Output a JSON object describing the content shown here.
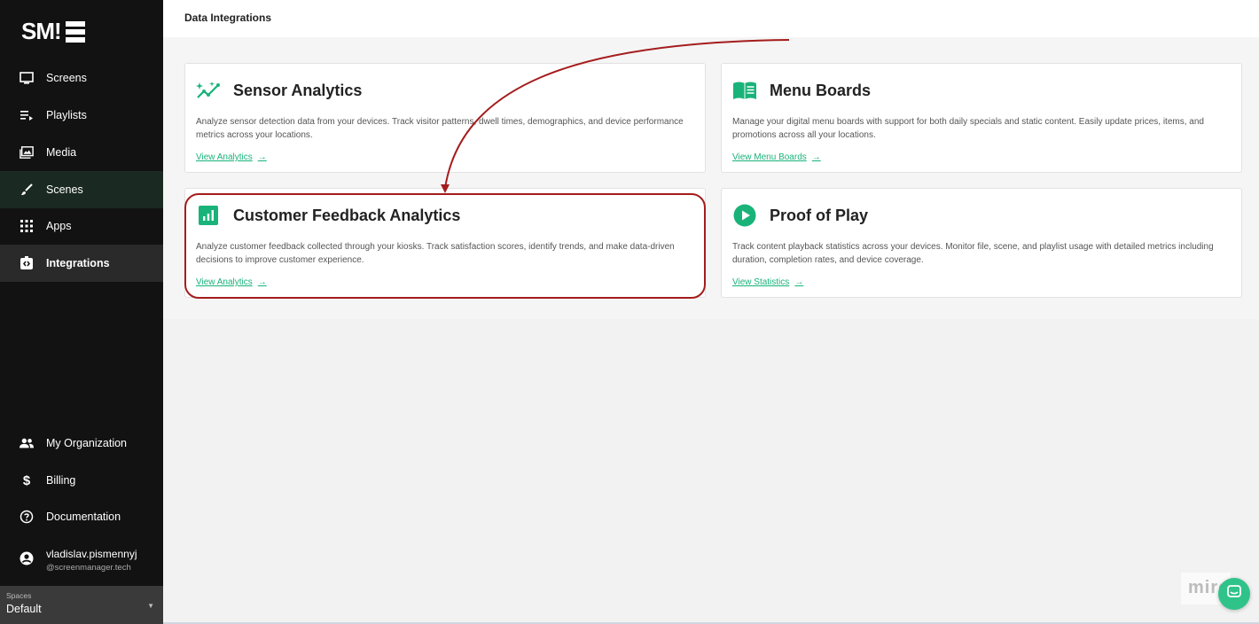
{
  "app": {
    "logo_text": "SM!",
    "logo_alt": "SM logo"
  },
  "sidebar": {
    "items": [
      {
        "label": "Screens",
        "icon": "monitor-icon"
      },
      {
        "label": "Playlists",
        "icon": "playlist-icon"
      },
      {
        "label": "Media",
        "icon": "media-icon"
      },
      {
        "label": "Scenes",
        "icon": "brush-icon"
      },
      {
        "label": "Apps",
        "icon": "apps-grid-icon"
      },
      {
        "label": "Integrations",
        "icon": "integrations-icon",
        "active": true
      }
    ],
    "bottom_items": [
      {
        "label": "My Organization",
        "icon": "people-icon"
      },
      {
        "label": "Billing",
        "icon": "dollar-icon"
      },
      {
        "label": "Documentation",
        "icon": "help-circle-icon"
      }
    ],
    "user": {
      "name": "vladislav.pismennyj",
      "email": "@screenmanager.tech"
    },
    "spaces": {
      "label": "Spaces",
      "value": "Default"
    }
  },
  "header": {
    "title": "Data Integrations"
  },
  "cards": [
    {
      "title": "Sensor Analytics",
      "icon": "sparkle-chart-icon",
      "description": "Analyze sensor detection data from your devices. Track visitor patterns, dwell times, demographics, and device performance metrics across your locations.",
      "link": "View Analytics",
      "arrow": "→"
    },
    {
      "title": "Menu Boards",
      "icon": "book-icon",
      "description": "Manage your digital menu boards with support for both daily specials and static content. Easily update prices, items, and promotions across all your locations.",
      "link": "View Menu Boards",
      "arrow": "→"
    },
    {
      "title": "Customer Feedback Analytics",
      "icon": "bar-chart-icon",
      "description": "Analyze customer feedback collected through your kiosks. Track satisfaction scores, identify trends, and make data-driven decisions to improve customer experience.",
      "link": "View Analytics",
      "arrow": "→"
    },
    {
      "title": "Proof of Play",
      "icon": "play-circle-icon",
      "description": "Track content playback statistics across your devices. Monitor file, scene, and playlist usage with detailed metrics including duration, completion rates, and device coverage.",
      "link": "View Statistics",
      "arrow": "→"
    }
  ],
  "overlay": {
    "miro_text": "miro"
  },
  "colors": {
    "accent": "#19b37a",
    "annotation": "#a51c1c",
    "sidebar_bg": "#121212"
  }
}
